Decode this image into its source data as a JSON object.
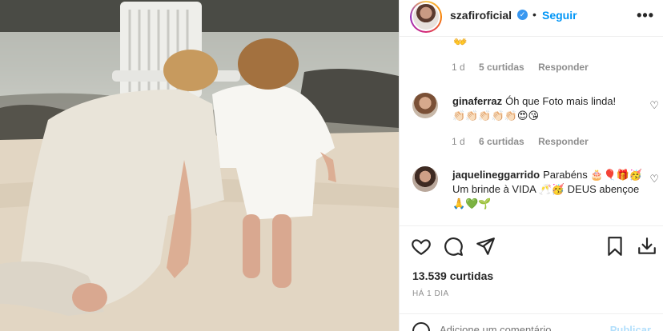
{
  "post": {
    "image_alt": "",
    "username": "szafiroficial",
    "verified_glyph": "✓",
    "dot": "•",
    "follow_label": "Seguir",
    "more_glyph": "•••"
  },
  "comments": {
    "top_emoji": "👐",
    "first_meta": {
      "time": "1 d",
      "likes": "5 curtidas",
      "reply": "Responder"
    },
    "items": [
      {
        "username": "ginaferraz",
        "text": "Óh que Foto mais linda!",
        "emoji": "👏🏻👏🏻👏🏻👏🏻👏🏻😍😘",
        "meta": {
          "time": "1 d",
          "likes": "6 curtidas",
          "reply": "Responder"
        }
      },
      {
        "username": "jaquelineggarrido",
        "text": "Parabéns 🎂🎈🎁🥳 Um brinde à VIDA 🥂🥳 DEUS abençoe 🙏💚🌱",
        "meta": null
      }
    ],
    "heart_glyph": "♡"
  },
  "actions": {
    "like_icon": "heart-icon",
    "comment_icon": "comment-icon",
    "share_icon": "share-icon",
    "save_icon": "bookmark-icon",
    "download_icon": "download-icon"
  },
  "stats": {
    "likes": "13.539 curtidas",
    "time": "HÁ 1 DIA"
  },
  "add_comment": {
    "placeholder": "Adicione um comentário...",
    "publish": "Publicar"
  },
  "colors": {
    "link_blue": "#0095f6",
    "verified_blue": "#3897f0",
    "muted_gray": "#8e8e8e",
    "text_dark": "#262626"
  }
}
